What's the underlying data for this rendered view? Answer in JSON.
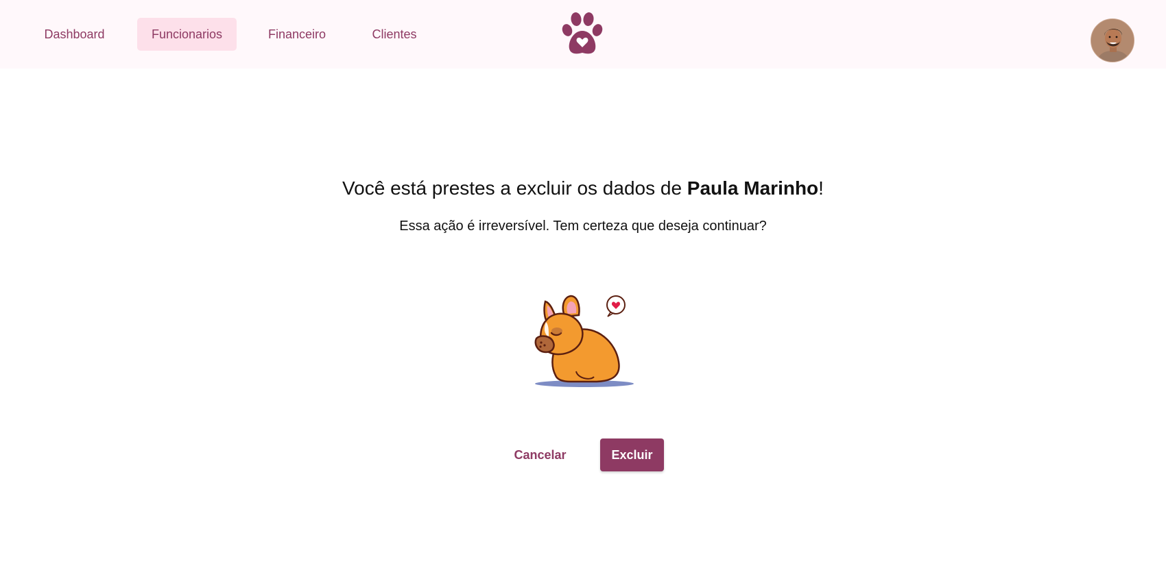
{
  "header": {
    "nav": [
      {
        "label": "Dashboard",
        "active": false
      },
      {
        "label": "Funcionarios",
        "active": true
      },
      {
        "label": "Financeiro",
        "active": false
      },
      {
        "label": "Clientes",
        "active": false
      }
    ],
    "logo_icon": "paw-heart-icon",
    "avatar_icon": "user-avatar"
  },
  "dialog": {
    "title_prefix": "Você está prestes a excluir os dados de ",
    "employee_name": "Paula Marinho",
    "title_suffix": "!",
    "message": "Essa ação é irreversível. Tem certeza que deseja continuar?",
    "illustration_icon": "sad-dog-illustration",
    "cancel_label": "Cancelar",
    "delete_label": "Excluir"
  },
  "colors": {
    "accent": "#8e3a63",
    "nav_active_bg": "#fde0ea",
    "header_bg": "#fff8fb"
  }
}
